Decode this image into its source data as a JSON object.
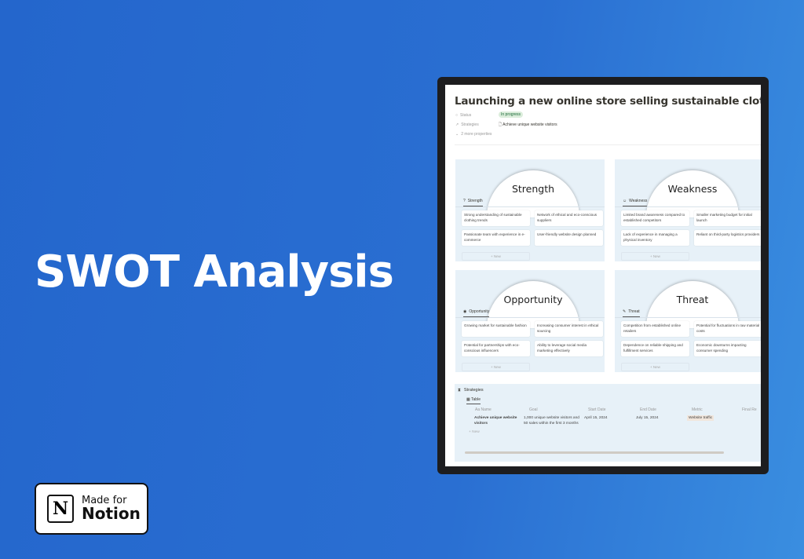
{
  "hero": {
    "title": "SWOT Analysis"
  },
  "badge": {
    "line1": "Made for",
    "line2": "Notion",
    "logo": "N"
  },
  "page": {
    "title": "Launching a new online store selling sustainable clothing",
    "properties": [
      {
        "label": "Status",
        "value": "In progress",
        "icon": "status-icon"
      },
      {
        "label": "Strategies",
        "value": "Achieve unique website visitors",
        "icon": "arrow-icon"
      }
    ],
    "more": "2 more properties"
  },
  "quadrants": [
    {
      "heading": "Strength",
      "tab": "Strength",
      "items": [
        "Strong understanding of sustainable clothing trends",
        "Network of ethical and eco-conscious suppliers",
        "Passionate team with experience in e-commerce",
        "User-friendly website design planned"
      ],
      "new": "+ New"
    },
    {
      "heading": "Weakness",
      "tab": "Weakness",
      "items": [
        "Limited brand awareness compared to established competitors",
        "Smaller marketing budget for initial launch",
        "Lack of experience in managing a physical inventory",
        "Reliant on third-party logistics providers"
      ],
      "new": "+ New"
    },
    {
      "heading": "Opportunity",
      "tab": "Opportunity",
      "items": [
        "Growing market for sustainable fashion",
        "Increasing consumer interest in ethical sourcing",
        "Potential for partnerships with eco-conscious influencers",
        "Ability to leverage social media marketing effectively"
      ],
      "new": "+ New"
    },
    {
      "heading": "Threat",
      "tab": "Threat",
      "items": [
        "Competition from established online retailers",
        "Potential for fluctuations in raw material costs",
        "Dependence on reliable shipping and fulfillment services",
        "Economic downturns impacting consumer spending"
      ],
      "new": "+ New"
    }
  ],
  "strategies": {
    "title": "Strategies",
    "view": "Table",
    "columns": [
      "Aa Name",
      "Goal",
      "Start Date",
      "End Date",
      "Metric",
      "Final Re"
    ],
    "row": {
      "name": "Achieve unique website visitors",
      "goal": "1,000 unique website visitors and 50 sales within the first 3 months",
      "start": "April 15, 2024",
      "end": "July 15, 2024",
      "metric": "Website traffic"
    },
    "new": "+ New"
  }
}
